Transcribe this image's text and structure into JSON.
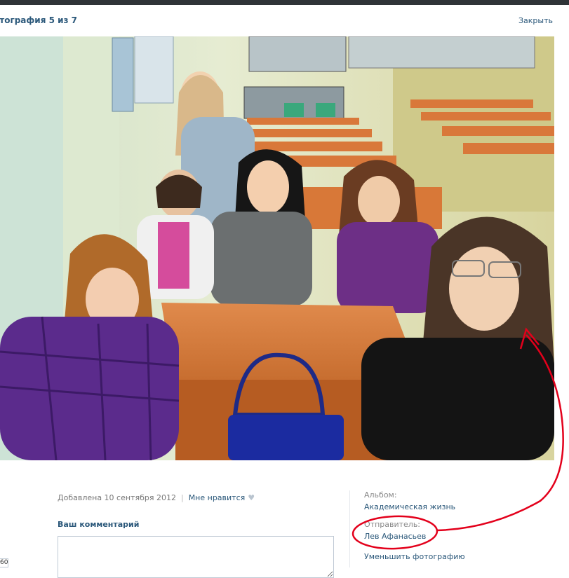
{
  "header": {
    "title": "отография 5 из 7",
    "close_label": "Закрыть"
  },
  "photo": {
    "scene_color": "#d9d4b6"
  },
  "meta": {
    "added": "Добавлена 10 сентября 2012",
    "separator": "|",
    "like_label": "Мне нравится",
    "heart_icon": "♥"
  },
  "comment": {
    "label": "Ваш комментарий",
    "placeholder": ""
  },
  "left_counter": {
    "value": "60"
  },
  "sidebar": {
    "album_label": "Альбом:",
    "album_name": "Академическая жизнь",
    "sender_label": "Отправитель:",
    "sender_name": "Лев Афанасьев",
    "shrink_label": "Уменьшить фотографию"
  },
  "colors": {
    "link": "#2b587a",
    "topbar": "#2f3438",
    "annotation": "#e3001b"
  }
}
